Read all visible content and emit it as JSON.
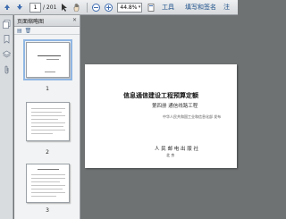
{
  "toolbar": {
    "prev_icon": "arrow-up-icon",
    "next_icon": "arrow-down-icon",
    "page_value": "1",
    "page_total": "/ 201",
    "zoom_value": "44.8%",
    "menu_tools": "工具",
    "menu_sign": "填写和签名",
    "menu_comment": "注"
  },
  "sidebar": {
    "panel_title": "页面缩略图",
    "thumbnails": [
      {
        "number": "1"
      },
      {
        "number": "2"
      },
      {
        "number": "3"
      }
    ]
  },
  "document": {
    "title": "信息通信建设工程预算定额",
    "subtitle": "第四册 通信线路工程",
    "editor": "中华人民共和国工业和信息化部 发布",
    "publisher": "人 民 邮 电 出 版 社",
    "city": "北 京"
  },
  "colors": {
    "background": "#6f7273",
    "menu_link": "#1b4f8a",
    "selection": "#8fb6e4"
  }
}
